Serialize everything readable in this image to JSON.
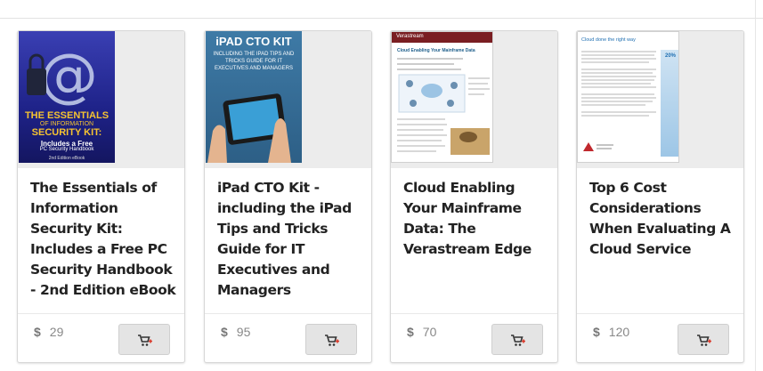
{
  "products": [
    {
      "title": "The Essentials of Information Security Kit: Includes a Free PC Security Handbook - 2nd Edition eBook",
      "currency": "$",
      "price": "29",
      "cover": {
        "line1": "THE ESSENTIALS",
        "line2": "OF INFORMATION",
        "line3": "SECURITY KIT:",
        "line4": "Includes a Free",
        "line5": "PC Security Handbook",
        "line6": "2nd Edition eBook"
      }
    },
    {
      "title": "iPad CTO Kit - including the iPad Tips and Tricks Guide for IT Executives and Managers",
      "currency": "$",
      "price": "95",
      "cover": {
        "line1": "iPAD CTO KIT",
        "line2": "INCLUDING THE IPAD TIPS AND TRICKS GUIDE FOR IT EXECUTIVES AND MANAGERS"
      }
    },
    {
      "title": "Cloud Enabling Your Mainframe Data: The Verastream Edge",
      "currency": "$",
      "price": "70",
      "cover": {
        "brand": "Verastream",
        "heading": "Cloud Enabling Your Mainframe Data"
      }
    },
    {
      "title": "Top 6 Cost Considerations When Evaluating A Cloud Service",
      "currency": "$",
      "price": "120",
      "cover": {
        "heading": "Cloud done the right way",
        "stat": "20%"
      }
    }
  ],
  "cart_icon": "shopping-cart-icon",
  "colors": {
    "cart_plus": "#d93a2b",
    "price_text": "#888888",
    "title_text": "#222222"
  }
}
